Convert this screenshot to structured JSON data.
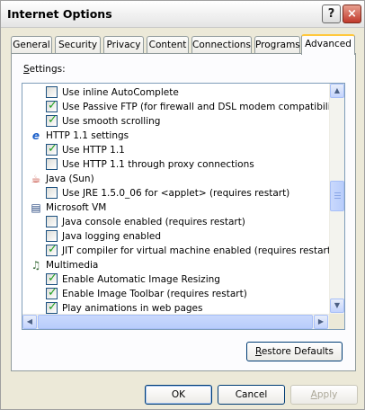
{
  "window": {
    "title": "Internet Options"
  },
  "titlebar_buttons": {
    "help": "?",
    "close": "×"
  },
  "tabs": [
    {
      "label": "General",
      "active": false
    },
    {
      "label": "Security",
      "active": false
    },
    {
      "label": "Privacy",
      "active": false
    },
    {
      "label": "Content",
      "active": false
    },
    {
      "label": "Connections",
      "active": false
    },
    {
      "label": "Programs",
      "active": false
    },
    {
      "label": "Advanced",
      "active": true
    }
  ],
  "settings": {
    "label_first": "S",
    "label_rest": "ettings:",
    "items": [
      {
        "kind": "option",
        "text": "Use inline AutoComplete",
        "checked": false
      },
      {
        "kind": "option",
        "text": "Use Passive FTP (for firewall and DSL modem compatibility)",
        "checked": true
      },
      {
        "kind": "option",
        "text": "Use smooth scrolling",
        "checked": true
      },
      {
        "kind": "category",
        "text": "HTTP 1.1 settings",
        "icon": "internet-explorer-icon"
      },
      {
        "kind": "option",
        "text": "Use HTTP 1.1",
        "checked": true
      },
      {
        "kind": "option",
        "text": "Use HTTP 1.1 through proxy connections",
        "checked": false
      },
      {
        "kind": "category",
        "text": "Java (Sun)",
        "icon": "java-cup-icon"
      },
      {
        "kind": "option",
        "text": "Use JRE 1.5.0_06 for <applet> (requires restart)",
        "checked": false
      },
      {
        "kind": "category",
        "text": "Microsoft VM",
        "icon": "document-icon"
      },
      {
        "kind": "option",
        "text": "Java console enabled (requires restart)",
        "checked": false
      },
      {
        "kind": "option",
        "text": "Java logging enabled",
        "checked": false
      },
      {
        "kind": "option",
        "text": "JIT compiler for virtual machine enabled (requires restart)",
        "checked": true
      },
      {
        "kind": "category",
        "text": "Multimedia",
        "icon": "multimedia-icon"
      },
      {
        "kind": "option",
        "text": "Enable Automatic Image Resizing",
        "checked": true
      },
      {
        "kind": "option",
        "text": "Enable Image Toolbar (requires restart)",
        "checked": true
      },
      {
        "kind": "option",
        "text": "Play animations in web pages",
        "checked": true
      }
    ]
  },
  "buttons": {
    "restore_first": "R",
    "restore_rest": "estore Defaults",
    "ok": "OK",
    "cancel": "Cancel",
    "apply_first": "A",
    "apply_rest": "pply"
  },
  "colors": {
    "window_bg": "#ece9d8",
    "panel_bg": "#fcfcfe",
    "check": "#21a121",
    "active_tab_accent": "#ffc83c",
    "list_border": "#7f9db9"
  }
}
